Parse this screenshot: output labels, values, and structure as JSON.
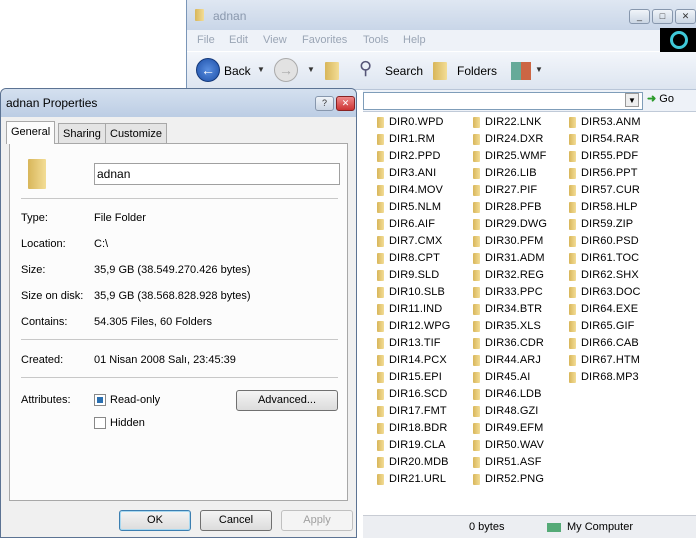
{
  "explorer": {
    "title": "adnan",
    "menu": [
      "File",
      "Edit",
      "View",
      "Favorites",
      "Tools",
      "Help"
    ],
    "toolbar": {
      "back": "Back",
      "search": "Search",
      "folders": "Folders"
    },
    "address": {
      "value": "",
      "go": "Go"
    },
    "columns": [
      [
        "DIR0.WPD",
        "DIR1.RM",
        "DIR2.PPD",
        "DIR3.ANI",
        "DIR4.MOV",
        "DIR5.NLM",
        "DIR6.AIF",
        "DIR7.CMX",
        "DIR8.CPT",
        "DIR9.SLD",
        "DIR10.SLB",
        "DIR11.IND",
        "DIR12.WPG",
        "DIR13.TIF",
        "DIR14.PCX",
        "DIR15.EPI",
        "DIR16.SCD",
        "DIR17.FMT",
        "DIR18.BDR",
        "DIR19.CLA",
        "DIR20.MDB",
        "DIR21.URL"
      ],
      [
        "DIR22.LNK",
        "DIR24.DXR",
        "DIR25.WMF",
        "DIR26.LIB",
        "DIR27.PIF",
        "DIR28.PFB",
        "DIR29.DWG",
        "DIR30.PFM",
        "DIR31.ADM",
        "DIR32.REG",
        "DIR33.PPC",
        "DIR34.BTR",
        "DIR35.XLS",
        "DIR36.CDR",
        "DIR44.ARJ",
        "DIR45.AI",
        "DIR46.LDB",
        "DIR48.GZI",
        "DIR49.EFM",
        "DIR50.WAV",
        "DIR51.ASF",
        "DIR52.PNG"
      ],
      [
        "DIR53.ANM",
        "DIR54.RAR",
        "DIR55.PDF",
        "DIR56.PPT",
        "DIR57.CUR",
        "DIR58.HLP",
        "DIR59.ZIP",
        "DIR60.PSD",
        "DIR61.TOC",
        "DIR62.SHX",
        "DIR63.DOC",
        "DIR64.EXE",
        "DIR65.GIF",
        "DIR66.CAB",
        "DIR67.HTM",
        "DIR68.MP3"
      ]
    ],
    "status": {
      "size": "0 bytes",
      "zone": "My Computer"
    }
  },
  "dialog": {
    "title": "adnan Properties",
    "tabs": [
      "General",
      "Sharing",
      "Customize"
    ],
    "name": "adnan",
    "type_label": "Type:",
    "type": "File Folder",
    "location_label": "Location:",
    "location": "C:\\",
    "size_label": "Size:",
    "size": "35,9 GB (38.549.270.426 bytes)",
    "disk_label": "Size on disk:",
    "disk": "35,9 GB (38.568.828.928 bytes)",
    "contains_label": "Contains:",
    "contains": "54.305 Files, 60 Folders",
    "created_label": "Created:",
    "created": "01 Nisan 2008 Salı, 23:45:39",
    "attributes_label": "Attributes:",
    "readonly": "Read-only",
    "readonly_state": "indeterminate",
    "hidden": "Hidden",
    "hidden_checked": false,
    "advanced": "Advanced...",
    "ok": "OK",
    "cancel": "Cancel",
    "apply": "Apply"
  }
}
